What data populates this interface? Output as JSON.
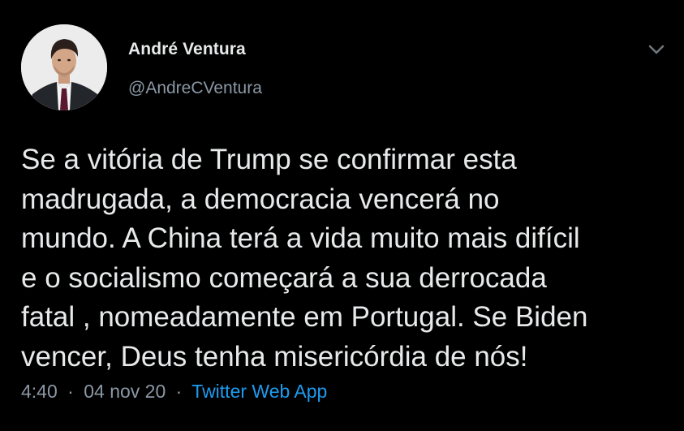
{
  "tweet": {
    "author": {
      "display_name": "André Ventura",
      "handle": "@AndreCVentura"
    },
    "text_lines": [
      "Se a vitória de Trump se confirmar esta",
      "madrugada, a democracia vencerá no",
      "mundo. A China terá a vida muito mais difícil",
      "e o socialismo começará a sua derrocada",
      "fatal , nomeadamente em Portugal. Se Biden",
      "vencer, Deus tenha misericórdia de nós!"
    ],
    "time": "4:40",
    "date": "04 nov 20",
    "separator": "·",
    "source": "Twitter Web App"
  },
  "icons": {
    "more_menu": "chevron-down-icon"
  },
  "colors": {
    "background": "#000000",
    "primary_text": "#e7e9ea",
    "secondary_text": "#8b98a5",
    "link": "#1d9bf0"
  }
}
